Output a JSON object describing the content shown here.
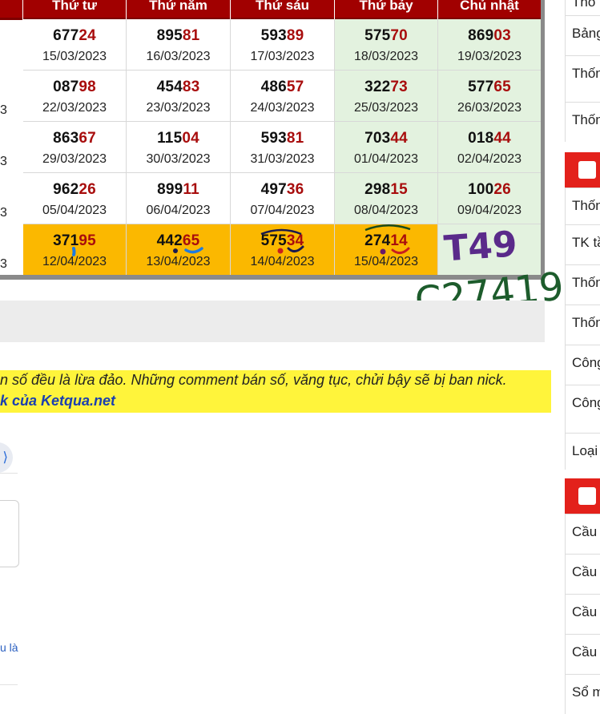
{
  "table": {
    "headers": [
      "Thứ tư",
      "Thứ năm",
      "Thứ sáu",
      "Thứ bảy",
      "Chủ nhật"
    ],
    "left_fragments": [
      "",
      "3",
      "3",
      "3",
      "3"
    ],
    "rows": [
      [
        {
          "n": "677",
          "t": "24",
          "d": "15/03/2023"
        },
        {
          "n": "895",
          "t": "81",
          "d": "16/03/2023"
        },
        {
          "n": "593",
          "t": "89",
          "d": "17/03/2023"
        },
        {
          "n": "575",
          "t": "70",
          "d": "18/03/2023"
        },
        {
          "n": "869",
          "t": "03",
          "d": "19/03/2023"
        }
      ],
      [
        {
          "n": "087",
          "t": "98",
          "d": "22/03/2023"
        },
        {
          "n": "454",
          "t": "83",
          "d": "23/03/2023"
        },
        {
          "n": "486",
          "t": "57",
          "d": "24/03/2023"
        },
        {
          "n": "322",
          "t": "73",
          "d": "25/03/2023"
        },
        {
          "n": "577",
          "t": "65",
          "d": "26/03/2023"
        }
      ],
      [
        {
          "n": "863",
          "t": "67",
          "d": "29/03/2023"
        },
        {
          "n": "115",
          "t": "04",
          "d": "30/03/2023"
        },
        {
          "n": "593",
          "t": "81",
          "d": "31/03/2023"
        },
        {
          "n": "703",
          "t": "44",
          "d": "01/04/2023"
        },
        {
          "n": "018",
          "t": "44",
          "d": "02/04/2023"
        }
      ],
      [
        {
          "n": "962",
          "t": "26",
          "d": "05/04/2023"
        },
        {
          "n": "899",
          "t": "11",
          "d": "06/04/2023"
        },
        {
          "n": "497",
          "t": "36",
          "d": "07/04/2023"
        },
        {
          "n": "298",
          "t": "15",
          "d": "08/04/2023"
        },
        {
          "n": "100",
          "t": "26",
          "d": "09/04/2023"
        }
      ],
      [
        {
          "n": "371",
          "t": "95",
          "d": "12/04/2023"
        },
        {
          "n": "442",
          "t": "65",
          "d": "13/04/2023"
        },
        {
          "n": "575",
          "t": "34",
          "d": "14/04/2023"
        },
        {
          "n": "274",
          "t": "14",
          "d": "15/04/2023"
        },
        {
          "n": "",
          "t": "",
          "d": ""
        }
      ]
    ]
  },
  "notice": {
    "line1": "n số đều là lừa đảo. Những comment bán số, văng tục, chửi bậy sẽ bị ban nick.",
    "line2": "k của Ketqua.net"
  },
  "comment": {
    "fragment": "u là"
  },
  "handwriting": {
    "note1": "T49",
    "note2": "C27419"
  },
  "sidebar": {
    "items": [
      "Thố",
      "Bảng",
      "Thốn theo",
      "Thốn",
      "Thốn",
      "TK tầ",
      "Thốn",
      "Thốn",
      "Công",
      "Công VIP",
      "Loại",
      "Cầu",
      "Cầu",
      "Cầu",
      "Cầu",
      "Sổ m"
    ]
  },
  "colors": {
    "header_red": "#a10000",
    "tail_red": "#a80d0d",
    "weekend_green": "#e3f2df",
    "highlight_yellow": "#fbb800",
    "notice_yellow": "#fff43b",
    "sidebar_red": "#e3211b"
  }
}
